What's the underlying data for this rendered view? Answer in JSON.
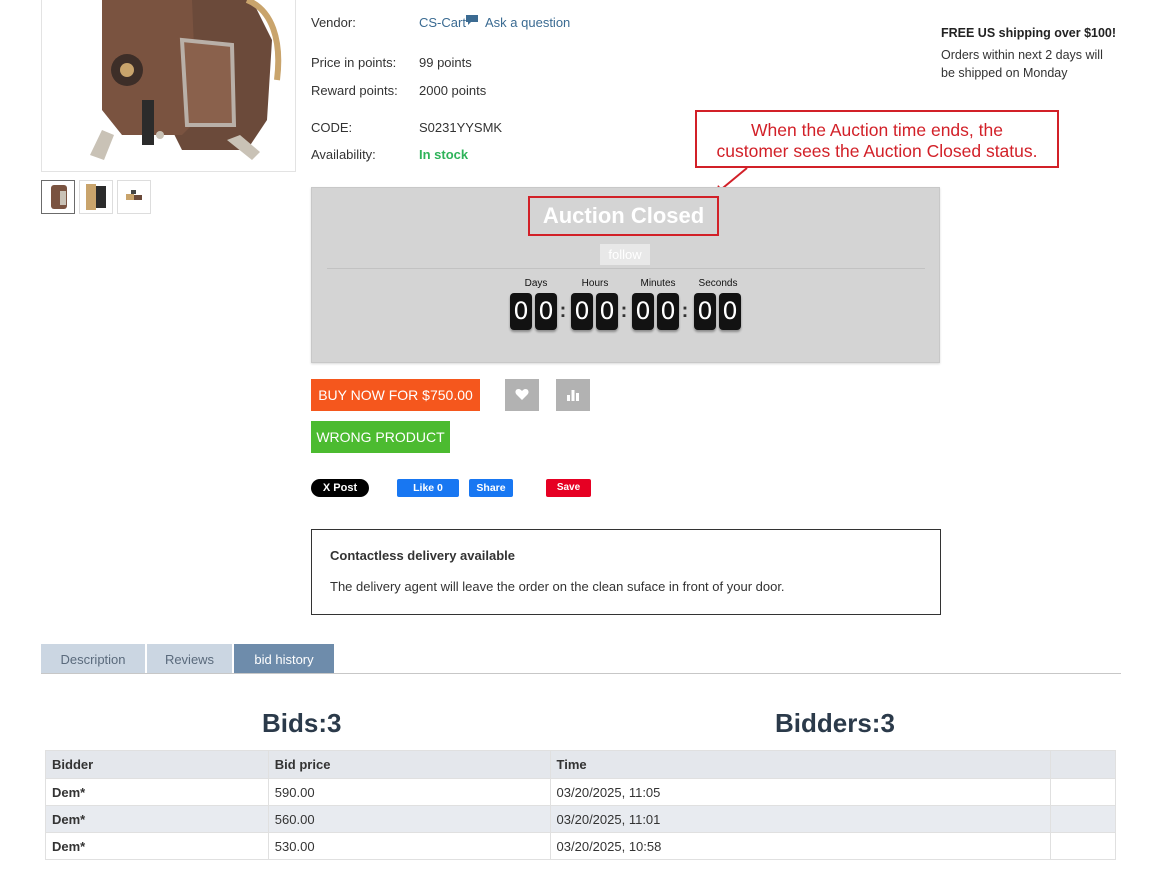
{
  "product": {
    "vendor_label": "Vendor:",
    "vendor_value": "CS-Cart",
    "ask_question": "Ask a question",
    "price_points_label": "Price in points:",
    "price_points_value": "99 points",
    "reward_points_label": "Reward points:",
    "reward_points_value": "2000 points",
    "code_label": "CODE:",
    "code_value": "S0231YYSMK",
    "availability_label": "Availability:",
    "availability_value": "In stock"
  },
  "shipping": {
    "title": "FREE US shipping over $100!",
    "line1": "Orders within next 2 days will",
    "line2": "be shipped on Monday"
  },
  "annotation": {
    "line1": "When the Auction time ends, the",
    "line2": "customer sees the Auction Closed status."
  },
  "auction": {
    "status": "Auction Closed",
    "follow": "follow",
    "units": [
      "Days",
      "Hours",
      "Minutes",
      "Seconds"
    ],
    "digits": [
      "0",
      "0",
      "0",
      "0",
      "0",
      "0",
      "0",
      "0"
    ]
  },
  "actions": {
    "buy_now": "BUY NOW FOR $750.00",
    "wrong_product": "WRONG PRODUCT"
  },
  "social": {
    "x_post": "X Post",
    "fb_like": "Like 0",
    "fb_share": "Share",
    "pin_save": "Save"
  },
  "delivery": {
    "title": "Contactless delivery available",
    "text": "The delivery agent will leave the order on the clean suface in front of your door."
  },
  "tabs": [
    "Description",
    "Reviews",
    "bid history"
  ],
  "bid_summary": {
    "bids": "Bids:3",
    "bidders": "Bidders:3"
  },
  "bid_table": {
    "headers": [
      "Bidder",
      "Bid price",
      "Time",
      ""
    ],
    "rows": [
      [
        "Dem*",
        "590.00",
        "03/20/2025, 11:05"
      ],
      [
        "Dem*",
        "560.00",
        "03/20/2025, 11:01"
      ],
      [
        "Dem*",
        "530.00",
        "03/20/2025, 10:58"
      ]
    ]
  },
  "colors": {
    "buy_button": "#f5571d",
    "wrong_button": "#4cbb30",
    "in_stock": "#2fb35a",
    "annotation": "#d22028",
    "active_tab": "#6e8cab"
  }
}
